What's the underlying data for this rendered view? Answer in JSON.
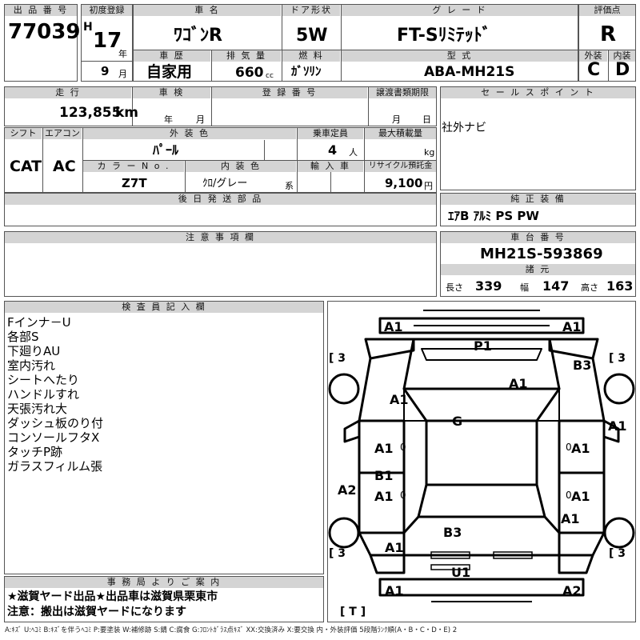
{
  "header": {
    "lot_label": "出 品 番 号",
    "lot_number": "77039",
    "first_reg_label": "初度登録",
    "era": "H",
    "year": "17",
    "year_unit": "年",
    "month": "9",
    "month_unit": "月",
    "car_name_label": "車 名",
    "car_name": "ﾜｺﾞﾝR",
    "door_label": "ドア形状",
    "door": "5W",
    "grade_label": "グ レ ー ド",
    "grade": "FT-Sﾘﾐﾃｯﾄﾞ",
    "score_label": "評価点",
    "score": "R",
    "history_label": "車 歴",
    "history": "自家用",
    "displacement_label": "排 気 量",
    "displacement": "660",
    "displacement_unit": "cc",
    "fuel_label": "燃 料",
    "fuel": "ｶﾞｿﾘﾝ",
    "model_label": "型 式",
    "model": "ABA-MH21S",
    "exterior_label": "外装",
    "exterior_grade": "C",
    "interior_label": "内装",
    "interior_grade": "D"
  },
  "row2": {
    "mileage_label": "走 行",
    "mileage": "123,855",
    "mileage_unit": "km",
    "inspection_label": "車 検",
    "year_unit": "年",
    "month_unit": "月",
    "reg_label": "登 録 番 号",
    "transfer_label": "譲渡書類期限",
    "transfer_month_unit": "月",
    "transfer_day_unit": "日",
    "sales_label": "セ ー ル ス ポ イ ン ト",
    "sales_text": "社外ナビ"
  },
  "row3": {
    "shift_label": "シフト",
    "shift": "CAT",
    "ac_label": "エアコン",
    "ac": "AC",
    "color_label": "外 装 色",
    "color": "ﾊﾟｰﾙ",
    "capacity_label": "乗車定員",
    "capacity": "4",
    "capacity_unit": "人",
    "load_label": "最大積載量",
    "load_unit": "kg",
    "color_no_label": "カ ラ ー N o .",
    "color_no": "Z7T",
    "interior_color_label": "内 装 色",
    "interior_color": "ｸﾛ/グレー",
    "interior_color_unit": "系",
    "import_label": "輸 入 車",
    "recycle_label": "リサイクル預託金",
    "recycle": "9,100",
    "recycle_unit": "円"
  },
  "later_parts_label": "後 日 発 送 部 品",
  "options_label": "純 正 装 備",
  "options": "ｴｱB ｱﾙﾐ PS PW",
  "notes_label": "注 意 事 項 欄",
  "chassis_label": "車 台 番 号",
  "chassis_number": "MH21S-593869",
  "specs_label": "諸 元",
  "length_label": "長さ",
  "length": "339",
  "width_label": "幅",
  "width": "147",
  "height_label": "高さ",
  "height": "163",
  "inspector_label": "検 査 員 記 入 欄",
  "inspector_notes": [
    "Fインナ－U",
    "各部S",
    "下廻りAU",
    "室内汚れ",
    "シートへたり",
    "ハンドルすれ",
    "天張汚れ大",
    "ダッシュ板のり付",
    "コンソールフタX",
    "タッチP跡",
    "ガラスフィルム張"
  ],
  "office_label": "事 務 局 よ り ご 案 内",
  "office_lines": [
    "★滋賀ヤード出品★出品車は滋賀県栗東市",
    "注意：搬出は滋賀ヤードになります"
  ],
  "legend": "A:ｷｽﾞ U:ﾍｺﾐ B:ｷｽﾞを伴うﾍｺﾐ P:要塗装 W:補修跡 S:錆 C:腐食 G:ﾌﾛﾝﾄｶﾞﾗｽ点ｷｽﾞ XX:交換済み X:要交換 内・外装評価 5段階ﾗﾝｸ順(A・B・C・D・E) 2",
  "damage_marks": {
    "a1_front_l": "A1",
    "a1_front_r": "A1",
    "p1": "P1",
    "b3_r": "B3",
    "a1_hood": "A1",
    "a1_left_fender": "A1",
    "g": "G",
    "a1_right": "A1",
    "a1_door_fl": "A1",
    "a1_door_fr": "A1",
    "b1": "B1",
    "a1_door_rl": "A1",
    "a2_left": "A2",
    "a1_door_rr": "A1",
    "a1_rear_r": "A1",
    "b3_roof": "B3",
    "a1_rear_l": "A1",
    "u1": "U1",
    "a1_bumper_rl": "A1",
    "a2_bumper_rr": "A2",
    "zero_fl": "0",
    "zero_fr": "0",
    "zero_rl": "0",
    "zero_rr": "0"
  },
  "tire_marks": {
    "fl": "3",
    "fr": "3",
    "rl": "3",
    "rr": "3",
    "spare": "T"
  }
}
